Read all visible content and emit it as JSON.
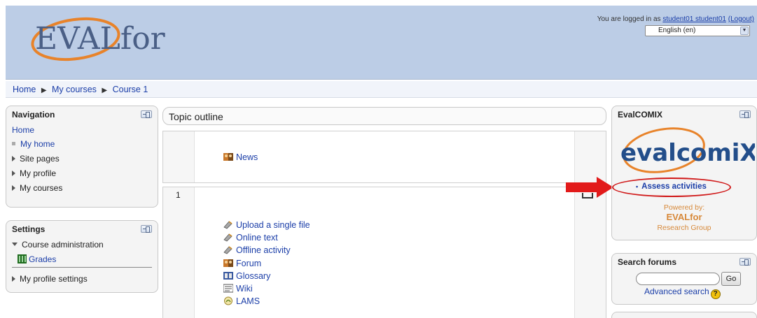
{
  "header": {
    "logo_text": "EVALfor",
    "login_prefix": "You are logged in as ",
    "user_link": "student01 student01",
    "logout_link": "(Logout)",
    "language": "English (en)"
  },
  "breadcrumb": [
    "Home",
    "My courses",
    "Course 1"
  ],
  "navigation": {
    "title": "Navigation",
    "home": "Home",
    "items": [
      "My home",
      "Site pages",
      "My profile",
      "My courses"
    ]
  },
  "settings": {
    "title": "Settings",
    "course_admin": "Course administration",
    "grades": "Grades",
    "profile_settings": "My profile settings"
  },
  "main": {
    "title": "Topic outline",
    "news": "News",
    "section_number": "1",
    "activities": [
      "Upload a single file",
      "Online text",
      "Offline activity",
      "Forum",
      "Glossary",
      "Wiki",
      "LAMS"
    ]
  },
  "evalcomix": {
    "title": "EvalCOMIX",
    "logo_text": "evalcomiX",
    "assess_link": "Assess activities",
    "powered_by": "Powered by:",
    "org": "EVALfor",
    "group": "Research Group"
  },
  "search_forums": {
    "title": "Search forums",
    "go": "Go",
    "advanced": "Advanced search"
  },
  "colors": {
    "header_bg": "#bccde6",
    "link": "#1b3ea8",
    "accent_red": "#e21a1a",
    "logo_orange": "#e8832a"
  }
}
